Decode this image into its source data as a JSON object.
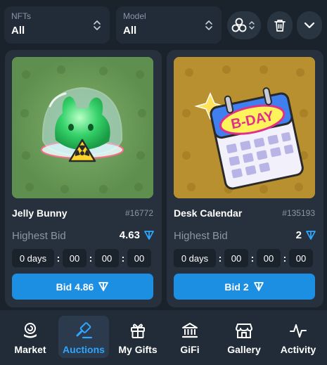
{
  "filters": {
    "nfts": {
      "label": "NFTs",
      "value": "All"
    },
    "model": {
      "label": "Model",
      "value": "All"
    }
  },
  "toolbar_icons": [
    "multi-select-icon",
    "trash-icon",
    "chevron-down-icon"
  ],
  "cards": [
    {
      "title": "Jelly Bunny",
      "number": "#16772",
      "bid_label": "Highest Bid",
      "bid_value": "4.63",
      "timer": {
        "days": "0 days",
        "hours": "00",
        "minutes": "00",
        "seconds": "00"
      },
      "button": "Bid 4.86",
      "background_color": "#5f8f4e"
    },
    {
      "title": "Desk Calendar",
      "number": "#135193",
      "bid_label": "Highest Bid",
      "bid_value": "2",
      "timer": {
        "days": "0 days",
        "hours": "00",
        "minutes": "00",
        "seconds": "00"
      },
      "button": "Bid 2",
      "background_color": "#b9902f"
    }
  ],
  "nav": [
    {
      "label": "Market",
      "icon": "market-icon",
      "active": false
    },
    {
      "label": "Auctions",
      "icon": "gavel-icon",
      "active": true
    },
    {
      "label": "My Gifts",
      "icon": "gift-icon",
      "active": false
    },
    {
      "label": "GiFi",
      "icon": "bank-icon",
      "active": false
    },
    {
      "label": "Gallery",
      "icon": "store-icon",
      "active": false
    },
    {
      "label": "Activity",
      "icon": "activity-icon",
      "active": false
    }
  ],
  "colors": {
    "accent": "#2ea6ff",
    "button": "#1c8fe3",
    "card": "#27313d",
    "background": "#1a222c"
  }
}
